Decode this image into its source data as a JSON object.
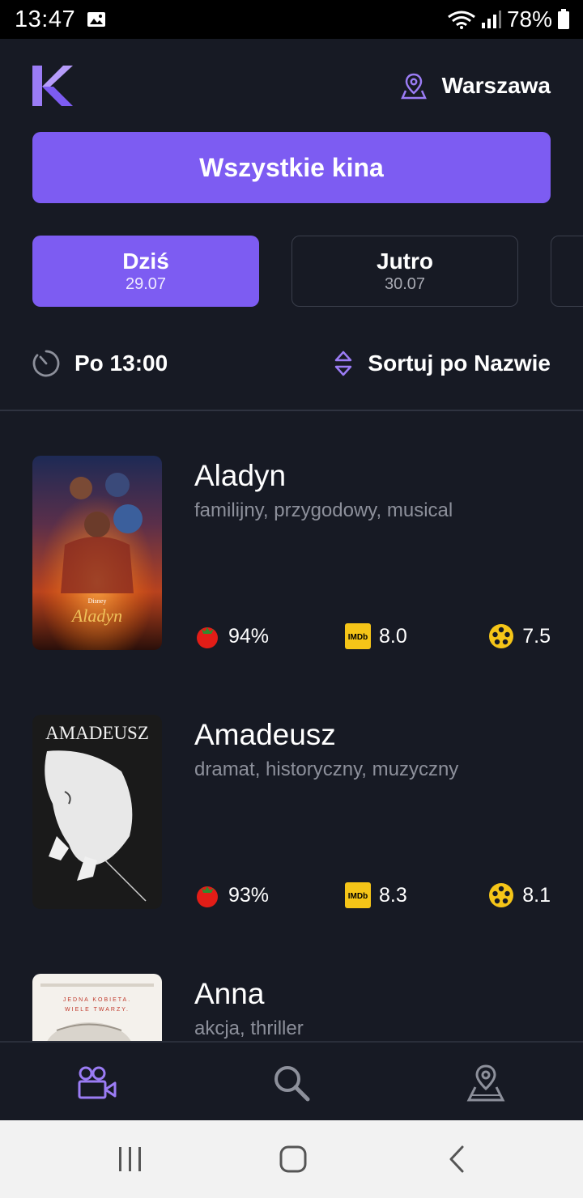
{
  "status_bar": {
    "time": "13:47",
    "battery": "78%",
    "icons": [
      "image-icon",
      "wifi-icon",
      "signal-icon",
      "battery-icon"
    ]
  },
  "header": {
    "logo": "K",
    "city": "Warszawa",
    "city_icon": "map-pin-icon"
  },
  "all_cinemas_label": "Wszystkie kina",
  "date_tabs": [
    {
      "day": "Dziś",
      "date": "29.07",
      "active": true
    },
    {
      "day": "Jutro",
      "date": "30.07",
      "active": false
    }
  ],
  "filters": {
    "time_label": "Po 13:00",
    "sort_label": "Sortuj po Nazwie"
  },
  "movies": [
    {
      "title": "Aladyn",
      "genres": "familijny, przygodowy, musical",
      "rt": "94%",
      "imdb": "8.0",
      "fw": "7.5"
    },
    {
      "title": "Amadeusz",
      "genres": "dramat, historyczny, muzyczny",
      "rt": "93%",
      "imdb": "8.3",
      "fw": "8.1"
    },
    {
      "title": "Anna",
      "genres": "akcja, thriller"
    }
  ],
  "posters": {
    "aladyn_brand": "Disney",
    "aladyn_title": "Aladyn",
    "amadeusz_title": "AMADEUSZ",
    "anna_tagline_1": "JEDNA KOBIETA.",
    "anna_tagline_2": "WIELE TWARZY."
  },
  "rating_labels": {
    "imdb_badge": "IMDb"
  },
  "colors": {
    "background": "#171a24",
    "accent": "#7d5cf2",
    "muted": "#8d909b",
    "imdb": "#f5c518",
    "filmweb": "#f5c518"
  },
  "bottom_nav": [
    "movie-camera-icon",
    "search-icon",
    "map-icon"
  ],
  "android_nav": [
    "recents-icon",
    "home-icon",
    "back-icon"
  ]
}
